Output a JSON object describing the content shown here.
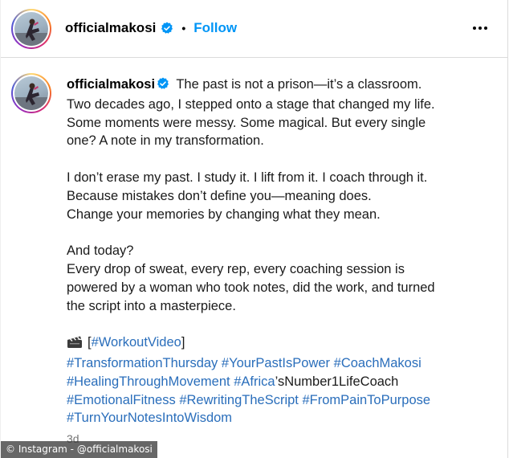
{
  "header": {
    "username": "officialmakosi",
    "separator": "•",
    "follow_label": "Follow"
  },
  "caption": {
    "username": "officialmakosi",
    "lines_p1": [
      "The past is not a prison—it’s a classroom.",
      "Two decades ago, I stepped onto a stage that changed my life.",
      "Some moments were messy. Some magical. But every single",
      "one? A note in my transformation."
    ],
    "lines_p2": [
      "I don’t erase my past. I study it. I lift from it. I coach through it.",
      "Because mistakes don’t define you—meaning does.",
      "Change your memories by changing what they mean."
    ],
    "lines_p3": [
      "And today?",
      "Every drop of sweat, every rep, every coaching session is",
      "powered by a woman who took notes, did the work, and turned",
      "the script into a masterpiece."
    ],
    "video_prefix": "[",
    "video_tag": "#WorkoutVideo",
    "video_suffix": "]",
    "hashtag_line1": [
      "#TransformationThursday",
      "#YourPastIsPower",
      "#CoachMakosi"
    ],
    "hashtag_line2_a": "#HealingThroughMovement",
    "hashtag_line2_b": "#Africa",
    "hashtag_line2_c": "’sNumber1LifeCoach",
    "hashtag_line3": [
      "#EmotionalFitness",
      "#RewritingTheScript",
      "#FromPainToPurpose"
    ],
    "hashtag_line4": "#TurnYourNotesIntoWisdom",
    "time": "3d"
  },
  "watermark": "© Instagram - @officialmakosi",
  "icons": {
    "verified": "verified-badge-icon",
    "more": "more-options-icon",
    "video": "clapper-board-icon"
  },
  "colors": {
    "follow": "#0095f6",
    "hashtag": "#2a6ebb",
    "verified": "#0095f6"
  }
}
